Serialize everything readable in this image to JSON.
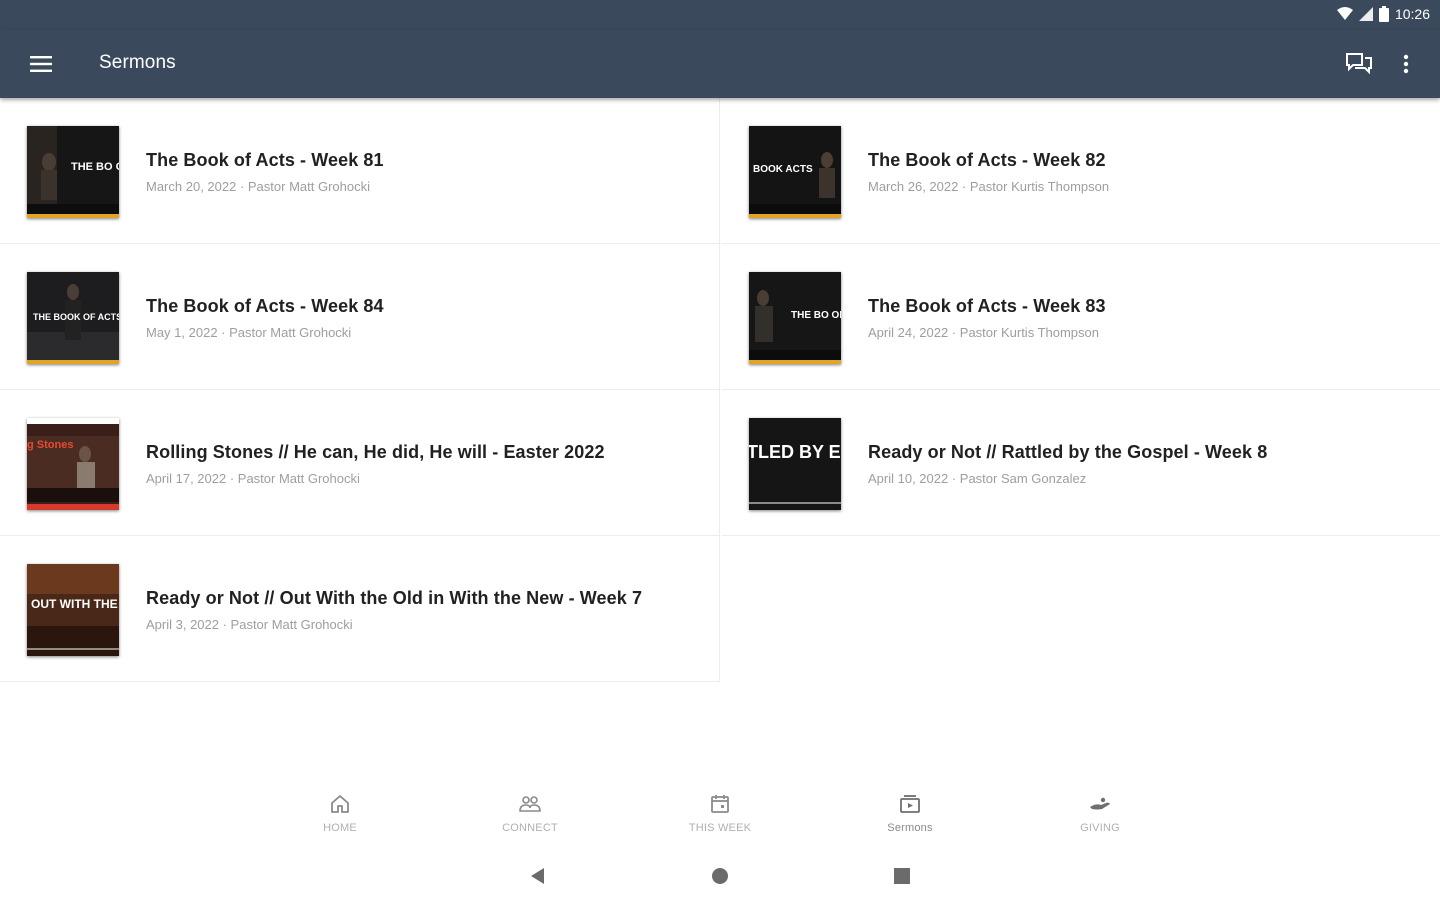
{
  "status_bar": {
    "time": "10:26"
  },
  "app_bar": {
    "title": "Sermons"
  },
  "sermons": [
    {
      "title": "The Book of Acts - Week 81",
      "meta": "March 20, 2022 · Pastor Matt Grohocki"
    },
    {
      "title": "The Book of Acts - Week 82",
      "meta": "March 26, 2022 · Pastor Kurtis Thompson"
    },
    {
      "title": "The Book of Acts - Week 84",
      "meta": "May 1, 2022 · Pastor Matt Grohocki"
    },
    {
      "title": "The Book of Acts - Week 83",
      "meta": "April 24, 2022 · Pastor Kurtis Thompson"
    },
    {
      "title": "Rolling Stones // He can, He did, He will - Easter 2022",
      "meta": "April 17, 2022 · Pastor Matt Grohocki"
    },
    {
      "title": "Ready or Not // Rattled by the Gospel - Week 8",
      "meta": "April 10, 2022 · Pastor Sam Gonzalez"
    },
    {
      "title": "Ready or Not // Out With the Old in With the New - Week 7",
      "meta": "April 3, 2022 · Pastor Matt Grohocki"
    }
  ],
  "thumbnails": [
    {
      "text": "THE BO OF AC",
      "accent": "#e0a526"
    },
    {
      "text": "BOOK ACTS",
      "accent": "#e0a526"
    },
    {
      "text": "THE BOOK OF ACTS",
      "accent": "#e0a526"
    },
    {
      "text": "THE BO OF AC",
      "accent": "#e0a526"
    },
    {
      "text": "g Stones",
      "accent": "#d63a2b"
    },
    {
      "text": "TLED BY E GOSPEL",
      "accent": "#ffffff"
    },
    {
      "text": "OUT WITH THE IN WITH THE",
      "accent": "#ffffff"
    }
  ],
  "bottom_nav": [
    {
      "label": "HOME",
      "icon": "home-icon"
    },
    {
      "label": "CONNECT",
      "icon": "people-icon"
    },
    {
      "label": "THIS WEEK",
      "icon": "calendar-icon"
    },
    {
      "label": "Sermons",
      "icon": "sermons-icon",
      "active": true
    },
    {
      "label": "GIVING",
      "icon": "giving-icon"
    }
  ],
  "colors": {
    "app_bar": "#3a4a5c",
    "accent_gold": "#e0a526",
    "meta_text": "#9e9e9e"
  }
}
